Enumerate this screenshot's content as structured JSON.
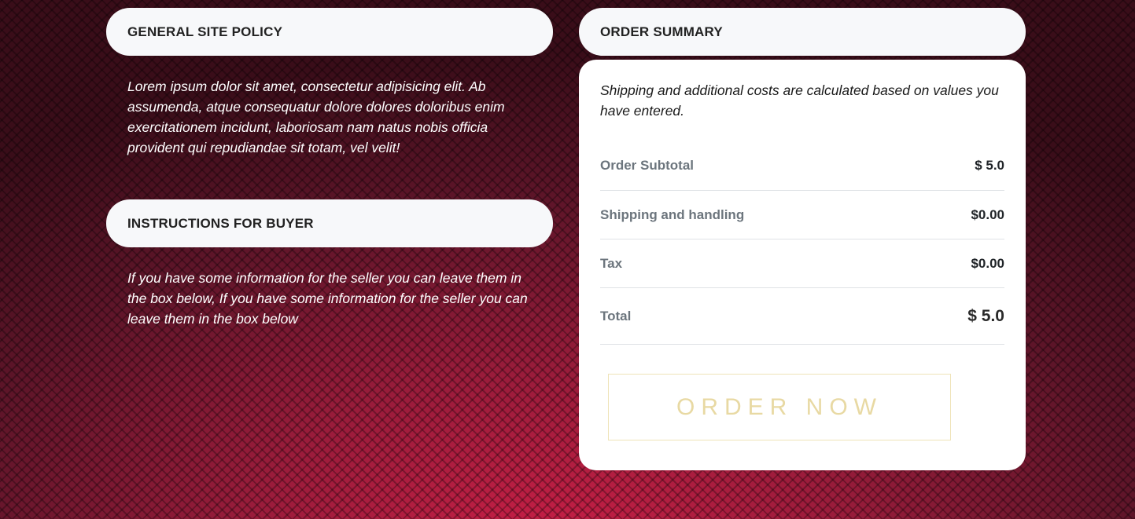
{
  "policy": {
    "title": "GENERAL SITE POLICY",
    "text": "Lorem ipsum dolor sit amet, consectetur adipisicing elit. Ab assumenda, atque consequatur dolore dolores doloribus enim exercitationem incidunt, laboriosam nam natus nobis officia provident qui repudiandae sit totam, vel velit!"
  },
  "instructions": {
    "title": "INSTRUCTIONS FOR BUYER",
    "text": "If you have some information for the seller you can leave them in the box below, If you have some information for the seller you can leave them in the box below"
  },
  "summary": {
    "title": "ORDER SUMMARY",
    "note": "Shipping and additional costs are calculated based on values you have entered.",
    "rows": [
      {
        "label": "Order Subtotal",
        "value": "$ 5.0"
      },
      {
        "label": "Shipping and handling",
        "value": "$0.00"
      },
      {
        "label": "Tax",
        "value": "$0.00"
      },
      {
        "label": "Total",
        "value": "$ 5.0"
      }
    ],
    "button_label": "ORDER NOW"
  }
}
